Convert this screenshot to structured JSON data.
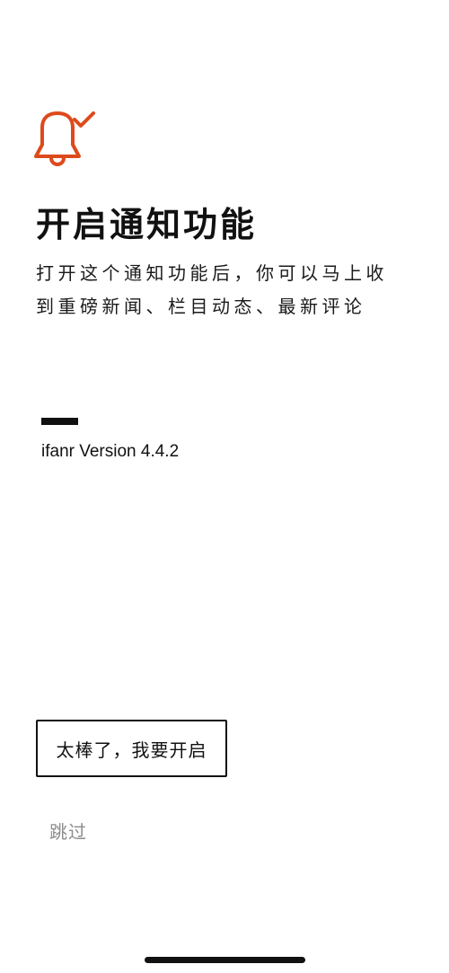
{
  "accent_color": "#dd4a1c",
  "icon": "bell-with-checkmark",
  "title": "开启通知功能",
  "description": {
    "line1": "打开这个通知功能后，你可以马上收",
    "line2": "到重磅新闻、栏目动态、最新评论"
  },
  "version_text": "ifanr Version 4.4.2",
  "enable_button_label": "太棒了，我要开启",
  "skip_label": "跳过"
}
